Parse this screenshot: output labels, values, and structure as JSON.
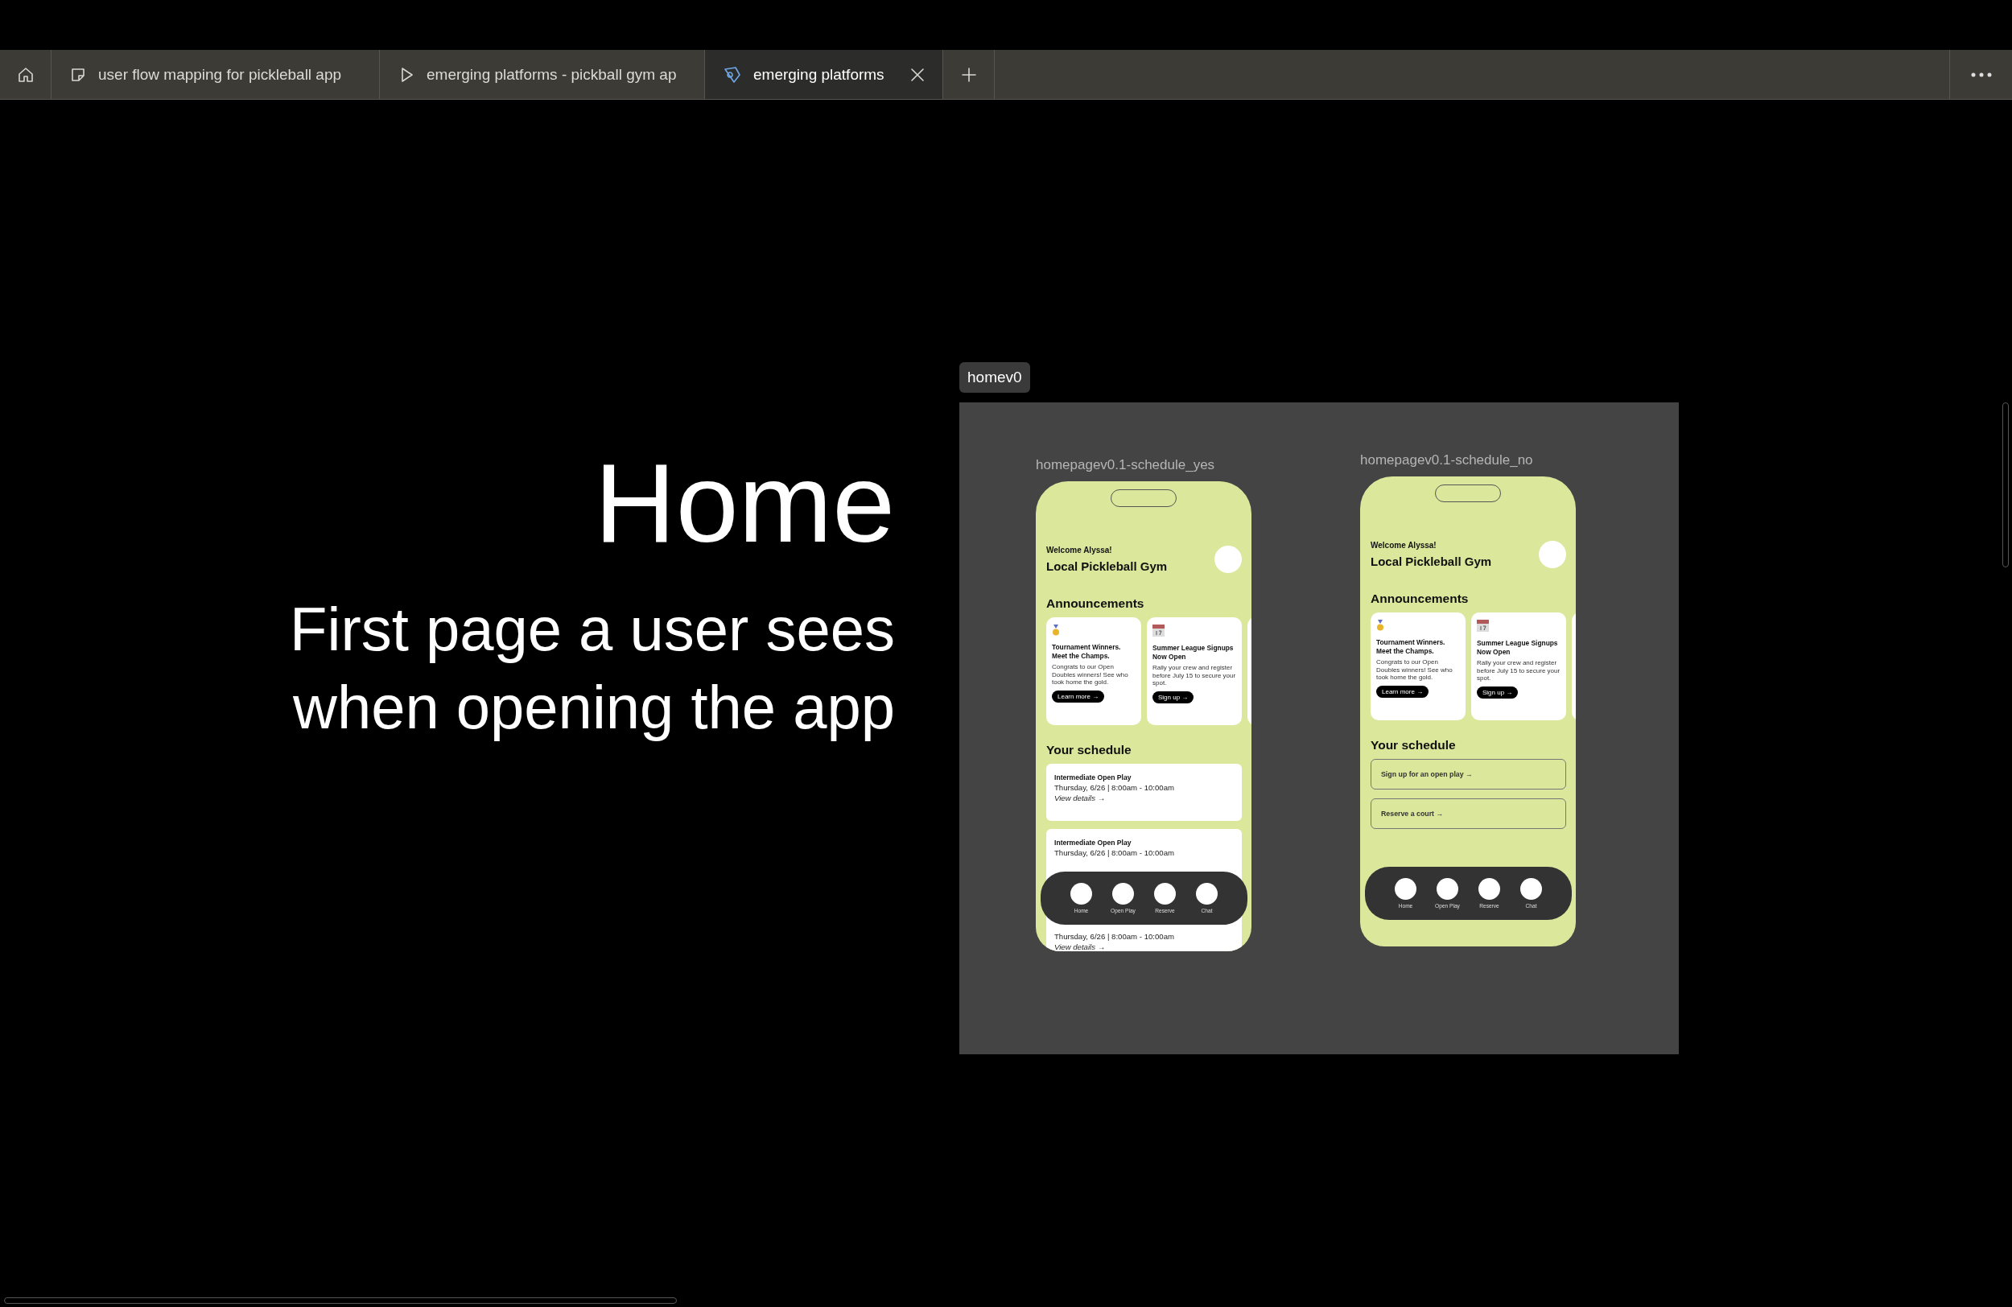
{
  "tabs": [
    {
      "kind": "home",
      "selected": false
    },
    {
      "kind": "board",
      "label": "user flow mapping for pickleball app",
      "selected": false
    },
    {
      "kind": "prototype",
      "label": "emerging platforms - pickball gym ap",
      "selected": false
    },
    {
      "kind": "design",
      "label": "emerging platforms",
      "selected": true
    }
  ],
  "canvas": {
    "heading": "Home",
    "subheading": "First page a user sees when opening the app",
    "section": {
      "label": "homev0",
      "phones": [
        {
          "label": "homepagev0.1-schedule_yes",
          "welcome": "Welcome Alyssa!",
          "gym": "Local Pickleball Gym",
          "announcements_heading": "Announcements",
          "announcements": [
            {
              "kind": "medal",
              "title": "Tournament Winners. Meet the Champs.",
              "body": "Congrats to our Open Doubles winners! See who took home the gold.",
              "button": "Learn more →"
            },
            {
              "kind": "calendar",
              "title": "Summer League Signups Now Open",
              "body": "Rally your crew and register before July 15 to secure your spot.",
              "button": "Sign up →"
            }
          ],
          "schedule_heading": "Your schedule",
          "schedule": [
            {
              "title": "Intermediate Open Play",
              "date": "Thursday, 6/26 | 8:00am - 10:00am",
              "link": "View details →"
            },
            {
              "title": "Intermediate Open Play",
              "date": "Thursday, 6/26 | 8:00am - 10:00am"
            },
            {
              "date": "Thursday, 6/26 | 8:00am - 10:00am",
              "link": "View details →"
            }
          ],
          "nav": [
            "Home",
            "Open Play",
            "Reserve",
            "Chat"
          ]
        },
        {
          "label": "homepagev0.1-schedule_no",
          "welcome": "Welcome Alyssa!",
          "gym": "Local Pickleball Gym",
          "announcements_heading": "Announcements",
          "announcements": [
            {
              "kind": "medal",
              "title": "Tournament Winners. Meet the Champs.",
              "body": "Congrats to our Open Doubles winners! See who took home the gold.",
              "button": "Learn more →"
            },
            {
              "kind": "calendar",
              "title": "Summer League Signups Now Open",
              "body": "Rally your crew and register before July 15 to secure your spot.",
              "button": "Sign up →"
            }
          ],
          "schedule_heading": "Your schedule",
          "actions": [
            "Sign up for an open play →",
            "Reserve a court →"
          ],
          "nav": [
            "Home",
            "Open Play",
            "Reserve",
            "Chat"
          ]
        }
      ]
    }
  }
}
